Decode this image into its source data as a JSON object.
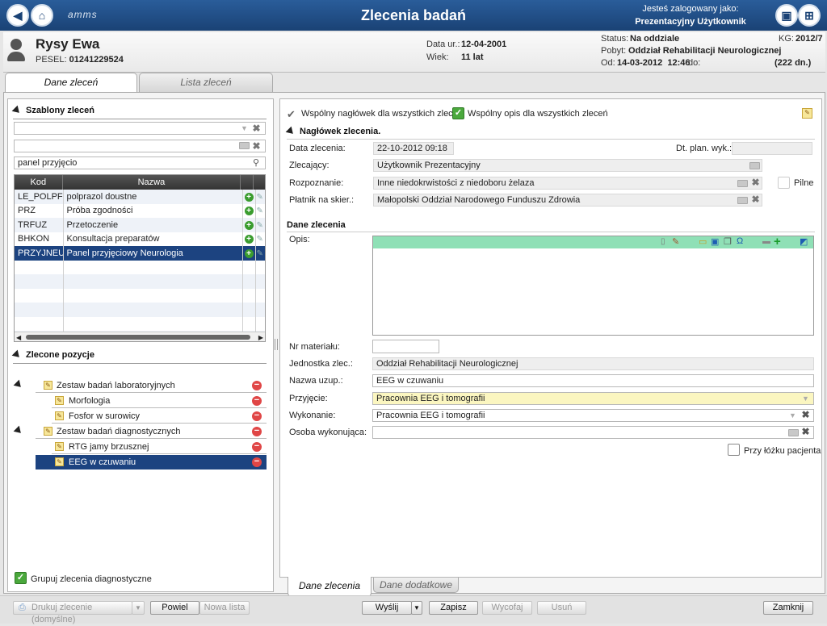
{
  "header": {
    "title": "Zlecenia badań",
    "logo": "amms",
    "logged_label": "Jesteś zalogowany jako:",
    "logged_user": "Prezentacyjny Użytkownik"
  },
  "patient": {
    "name": "Rysy Ewa",
    "pesel_label": "PESEL:",
    "pesel": "01241229524",
    "dob_label": "Data ur.:",
    "dob": "12-04-2001",
    "age_label": "Wiek:",
    "age": "11 lat",
    "status_label": "Status:",
    "status": "Na oddziale",
    "kg_label": "KG:",
    "kg": "2012/7",
    "stay_label": "Pobyt:",
    "stay": "Oddział Rehabilitacji Neurologicznej",
    "from_label": "Od:",
    "from": "14-03-2012  12:46",
    "to_label": "do:",
    "days": "(222 dn.)"
  },
  "tabs": {
    "orders": "Dane zleceń",
    "list": "Lista zleceń"
  },
  "templates": {
    "title": "Szablony zleceń",
    "search_value": "panel przyjęcio",
    "col_code": "Kod",
    "col_name": "Nazwa",
    "rows": [
      {
        "code": "LE_POLPF",
        "name": "polprazol doustne"
      },
      {
        "code": "PRZ",
        "name": "Próba zgodności"
      },
      {
        "code": "TRFUZ",
        "name": "Przetoczenie"
      },
      {
        "code": "BHKON",
        "name": "Konsultacja preparatów"
      },
      {
        "code": "PRZYJNEU",
        "name": "Panel przyjęciowy Neurologia"
      }
    ]
  },
  "ordered": {
    "title": "Zlecone pozycje",
    "groups": [
      {
        "label": "Zestaw badań laboratoryjnych",
        "items": [
          "Morfologia",
          "Fosfor w surowicy"
        ]
      },
      {
        "label": "Zestaw badań diagnostycznych",
        "items": [
          "RTG jamy brzusznej",
          "EEG w czuwaniu"
        ]
      }
    ],
    "group_checkbox": "Grupuj zlecenia diagnostyczne"
  },
  "form": {
    "common_header": "Wspólny nagłówek dla wszystkich zleceń",
    "common_desc": "Wspólny opis dla wszystkich zleceń",
    "header_section": "Nagłówek zlecenia.",
    "date_label": "Data zlecenia:",
    "date": "22-10-2012 09:18",
    "plan_label": "Dt. plan. wyk.:",
    "orderer_label": "Zlecający:",
    "orderer": "Użytkownik Prezentacyjny",
    "diag_label": "Rozpoznanie:",
    "diag": "Inne niedokrwistości z niedoboru żelaza",
    "urgent": "Pilne",
    "payer_label": "Płatnik na skier.:",
    "payer": "Małopolski Oddział Narodowego Funduszu Zdrowia",
    "data_section": "Dane zlecenia",
    "desc_label": "Opis:",
    "material_label": "Nr materiału:",
    "unit_label": "Jednostka zlec.:",
    "unit": "Oddział Rehabilitacji Neurologicznej",
    "short_label": "Nazwa uzup.:",
    "short": "EEG w czuwaniu",
    "admit_label": "Przyjęcie:",
    "admit": "Pracownia EEG i tomografii",
    "exec_label": "Wykonanie:",
    "exec": "Pracownia EEG i tomografii",
    "person_label": "Osoba wykonująca:",
    "bedside": "Przy łóżku pacjenta"
  },
  "bottom_tabs": {
    "order": "Dane zlecenia",
    "extra": "Dane dodatkowe"
  },
  "buttons": {
    "print": "Drukuj zlecenie (domyślne)",
    "repeat": "Powiel",
    "new_list": "Nowa lista",
    "send": "Wyślij",
    "save": "Zapisz",
    "revoke": "Wycofaj",
    "delete": "Usuń",
    "close": "Zamknij"
  }
}
